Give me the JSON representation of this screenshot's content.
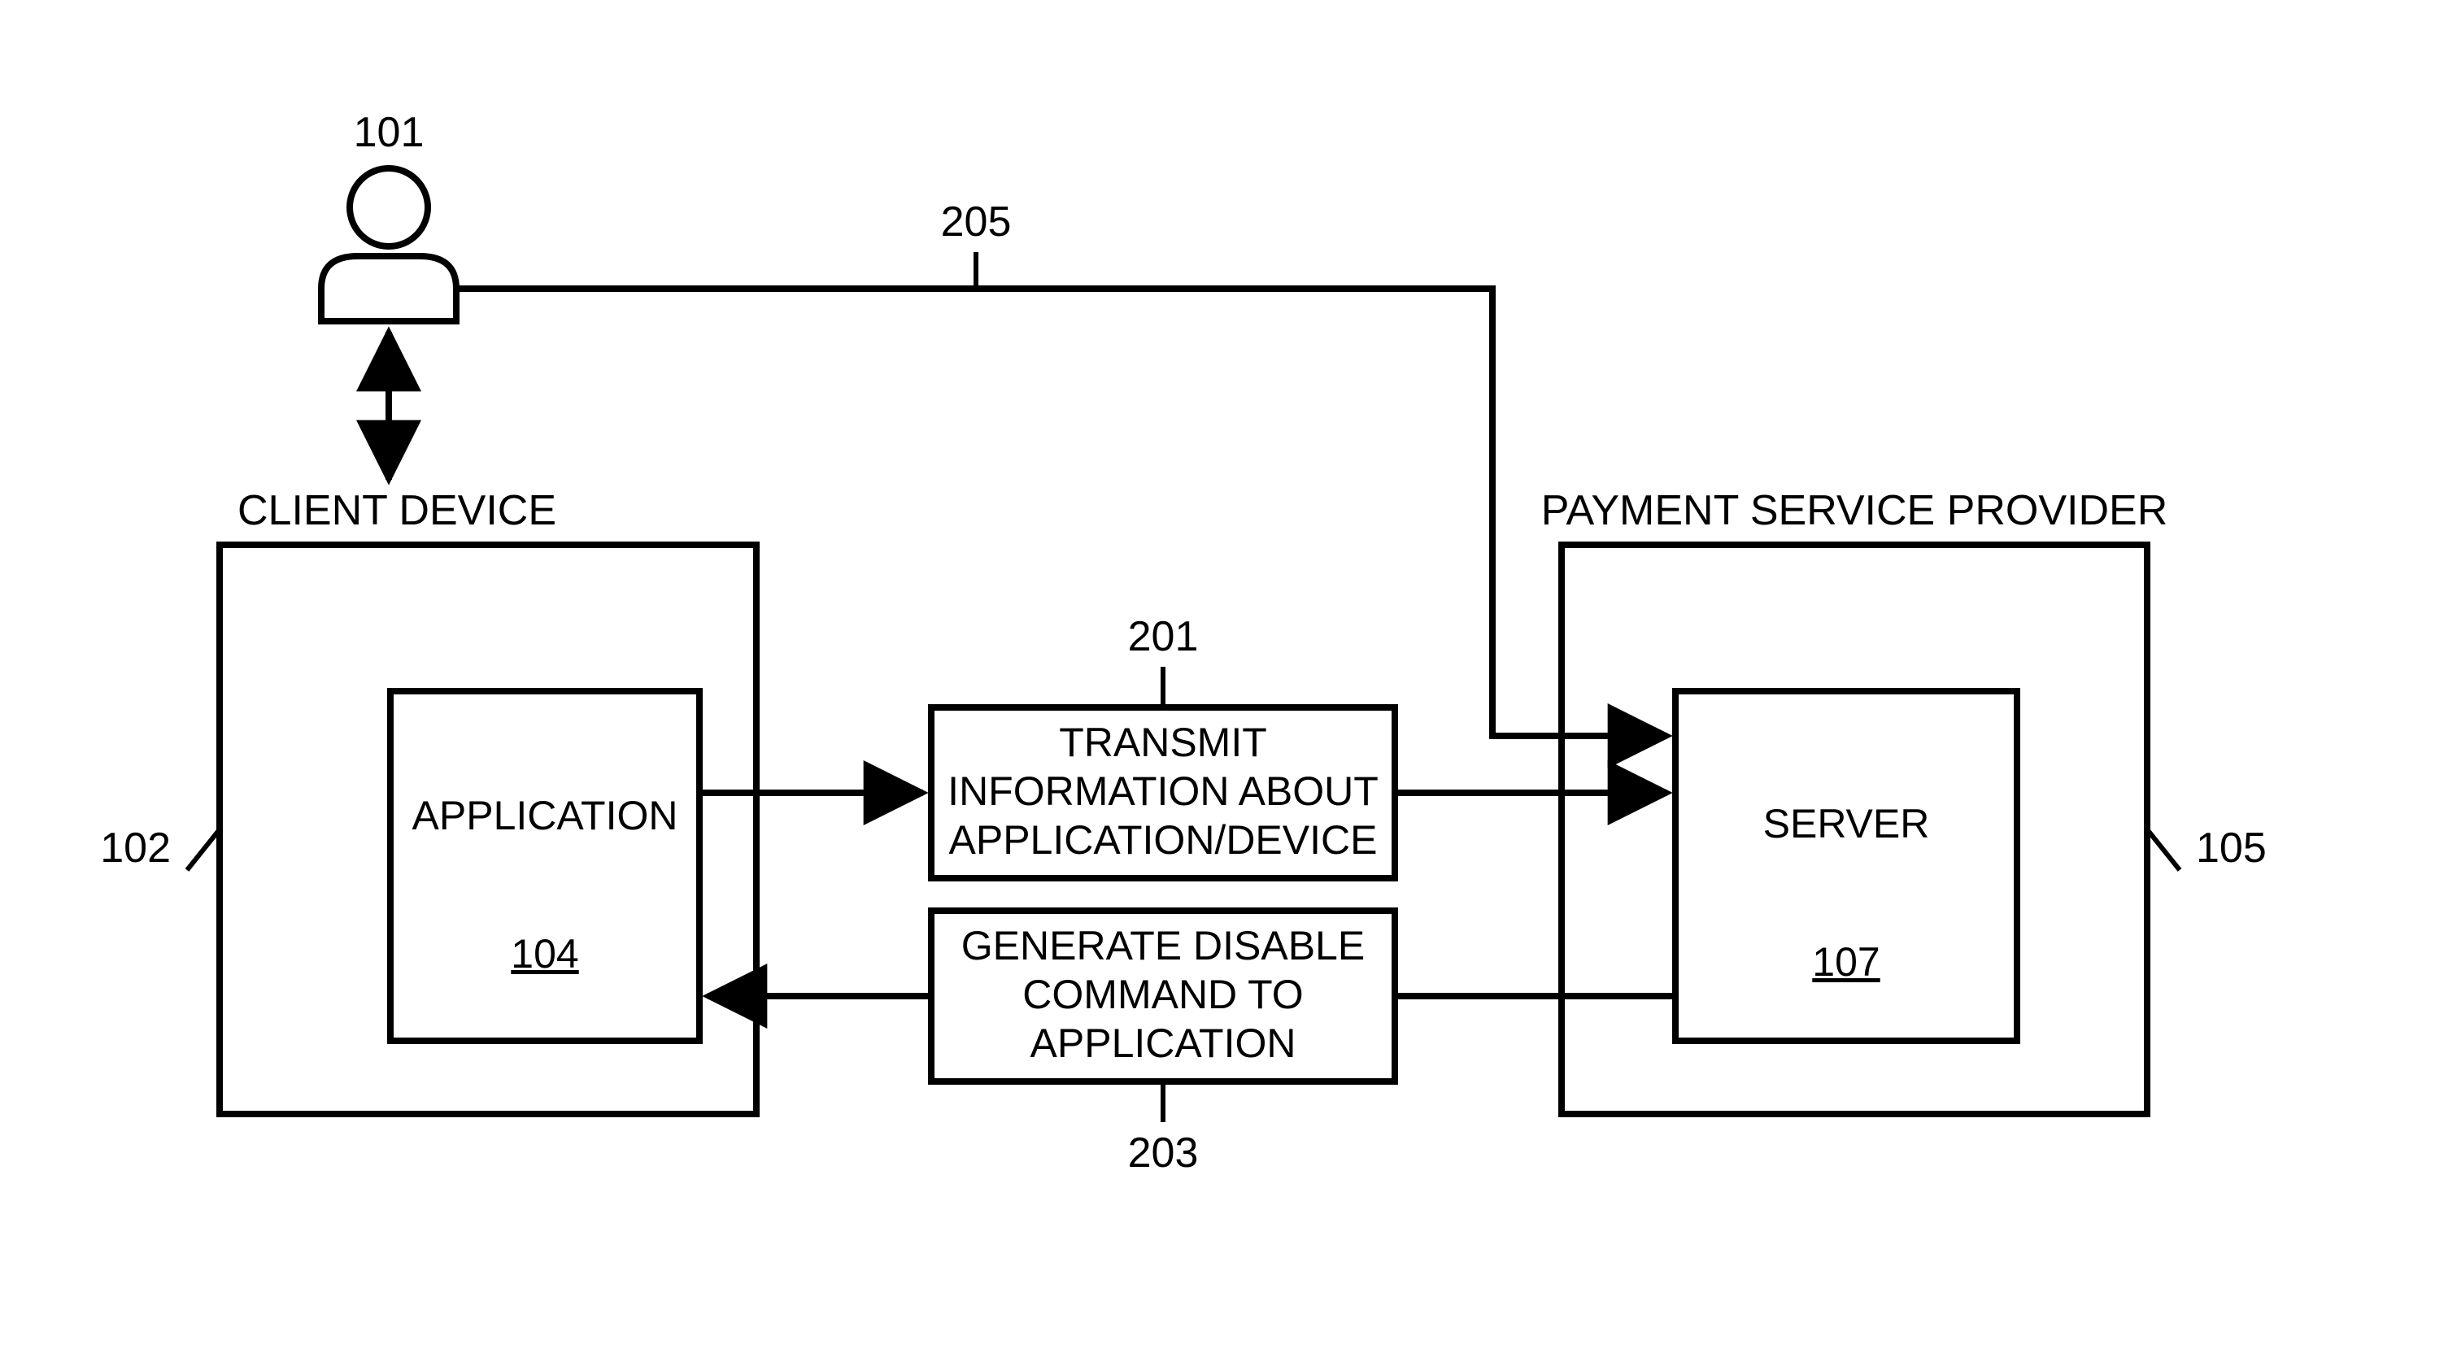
{
  "diagram": {
    "user": {
      "ref": "101"
    },
    "clientDevice": {
      "title": "CLIENT DEVICE",
      "ref": "102",
      "application": {
        "label": "APPLICATION",
        "ref": "104"
      }
    },
    "psp": {
      "title": "PAYMENT SERVICE PROVIDER",
      "ref": "105",
      "server": {
        "label": "SERVER",
        "ref": "107"
      }
    },
    "transmit": {
      "line1": "TRANSMIT",
      "line2": "INFORMATION ABOUT",
      "line3": "APPLICATION/DEVICE",
      "ref": "201"
    },
    "generate": {
      "line1": "GENERATE DISABLE",
      "line2": "COMMAND TO",
      "line3": "APPLICATION",
      "ref": "203"
    },
    "userToServerRef": "205"
  }
}
